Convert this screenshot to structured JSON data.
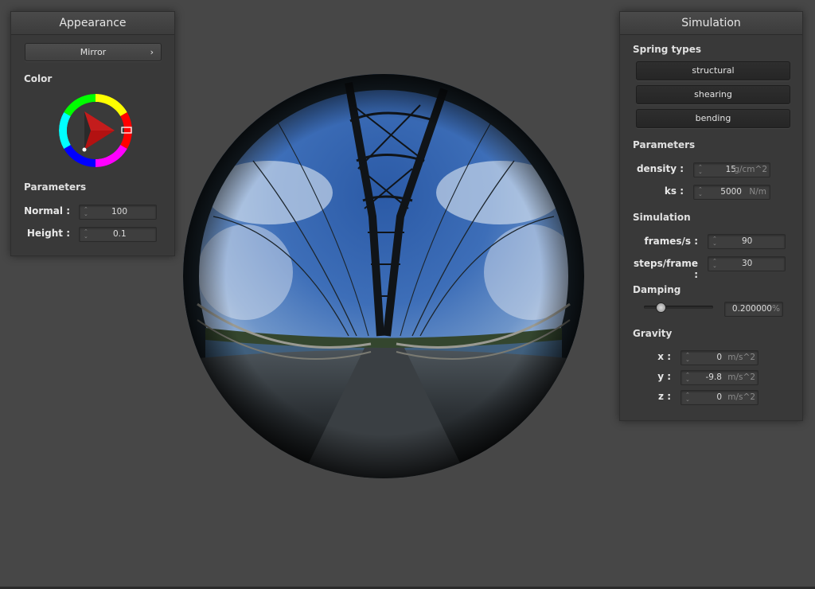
{
  "appearance": {
    "title": "Appearance",
    "material_dropdown": "Mirror",
    "dropdown_arrow": "›",
    "color_label": "Color",
    "parameters_label": "Parameters",
    "normal": {
      "label": "Normal :",
      "value": "100"
    },
    "height": {
      "label": "Height :",
      "value": "0.1"
    },
    "color_wheel": {
      "selected_hue": "#ff0000",
      "wheel_icon": "color-wheel-icon"
    }
  },
  "simulation": {
    "title": "Simulation",
    "spring_types_label": "Spring types",
    "spring_buttons": [
      "structural",
      "shearing",
      "bending"
    ],
    "parameters_label": "Parameters",
    "density": {
      "label": "density :",
      "value": "15",
      "unit": "g/cm^2"
    },
    "ks": {
      "label": "ks :",
      "value": "5000",
      "unit": "N/m"
    },
    "simulation_label": "Simulation",
    "frames": {
      "label": "frames/s :",
      "value": "90"
    },
    "steps": {
      "label": "steps/frame :",
      "value": "30"
    },
    "damping_label": "Damping",
    "damping": {
      "value": "0.200000",
      "unit": "%",
      "slider_fraction": 0.2
    },
    "gravity_label": "Gravity",
    "gravity": [
      {
        "label": "x :",
        "value": "0",
        "unit": "m/s^2"
      },
      {
        "label": "y :",
        "value": "-9.8",
        "unit": "m/s^2"
      },
      {
        "label": "z :",
        "value": "0",
        "unit": "m/s^2"
      }
    ]
  },
  "viewport": {
    "object": "mirror-sphere",
    "background_color": "#474747"
  }
}
